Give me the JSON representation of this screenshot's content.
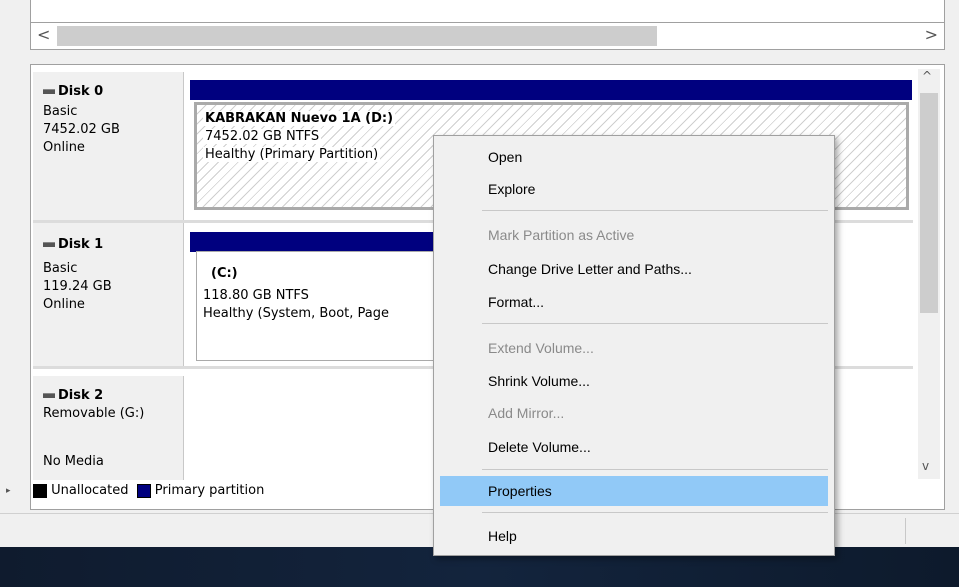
{
  "disks": [
    {
      "name": "Disk 0",
      "type": "Basic",
      "size": "7452.02 GB",
      "status": "Online"
    },
    {
      "name": "Disk 1",
      "type": "Basic",
      "size": "119.24 GB",
      "status": "Online"
    },
    {
      "name": "Disk 2",
      "type": "Removable (G:)",
      "status": "No Media"
    }
  ],
  "partitions": [
    {
      "name": "KABRAKAN Nuevo 1A  (D:)",
      "detail": "7452.02 GB NTFS",
      "health": "Healthy (Primary Partition)"
    },
    {
      "name": "(C:)",
      "detail": "118.80 GB NTFS",
      "health": "Healthy (System, Boot, Page"
    }
  ],
  "legend": {
    "unallocated": "Unallocated",
    "primary": "Primary partition"
  },
  "colors": {
    "primary": "#00007f",
    "unallocated": "#000000",
    "highlight": "#91c9f7"
  },
  "scroll": {
    "left": "<",
    "right": ">",
    "up": "^",
    "down": "v"
  },
  "menu": {
    "open": "Open",
    "explore": "Explore",
    "mark_active": "Mark Partition as Active",
    "change_letter": "Change Drive Letter and Paths...",
    "format": "Format...",
    "extend": "Extend Volume...",
    "shrink": "Shrink Volume...",
    "add_mirror": "Add Mirror...",
    "delete": "Delete Volume...",
    "properties": "Properties",
    "help": "Help"
  }
}
